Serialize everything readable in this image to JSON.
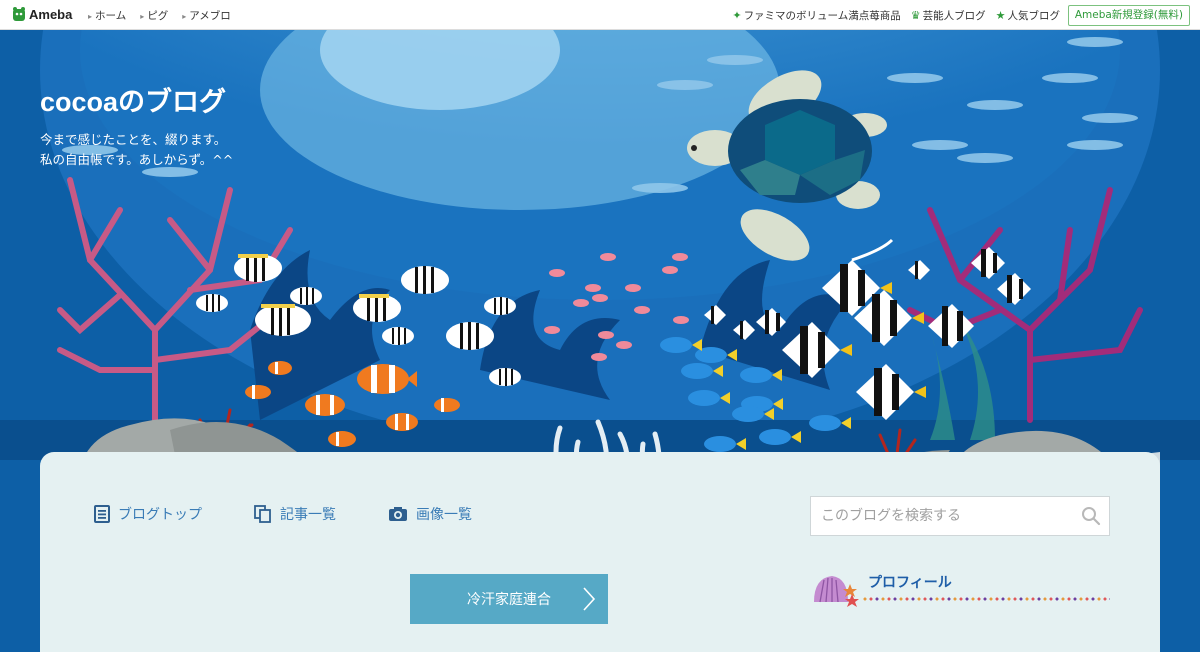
{
  "header": {
    "logo_text": "Ameba",
    "nav": [
      "ホーム",
      "ピグ",
      "アメブロ"
    ],
    "right_links": [
      {
        "label": "ファミマのボリューム満点苺商品",
        "icon": "sparkle-icon"
      },
      {
        "label": "芸能人ブログ",
        "icon": "crown-icon"
      },
      {
        "label": "人気ブログ",
        "icon": "star-icon"
      }
    ],
    "register": "Ameba新規登録(無料)"
  },
  "blog": {
    "title": "cocoaのブログ",
    "desc_line1": "今まで感じたことを、綴ります。",
    "desc_line2": "私の自由帳です。あしからず。^^"
  },
  "tabs": {
    "top": "ブログトップ",
    "articles": "記事一覧",
    "images": "画像一覧"
  },
  "search": {
    "placeholder": "このブログを検索する"
  },
  "category_button": "冷汗家庭連合",
  "profile": {
    "title": "プロフィール"
  },
  "colors": {
    "accent": "#2f9a3a",
    "link": "#3a7cb6",
    "ocean": "#0d5fa6",
    "panel": "#e5f1f2"
  }
}
